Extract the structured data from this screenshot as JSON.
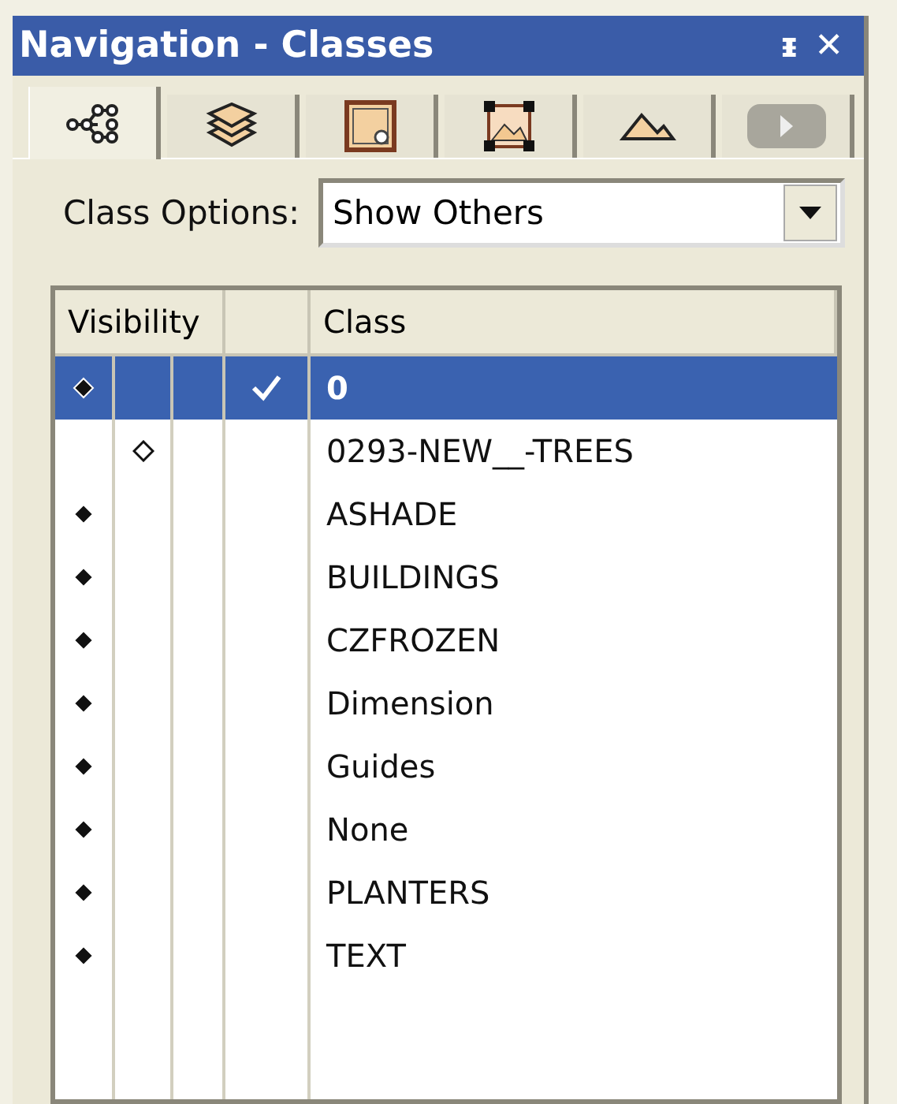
{
  "window": {
    "title": "Navigation - Classes",
    "pin": "ᵻ",
    "close": "✕"
  },
  "tabs": [
    {
      "kind": "hierarchy",
      "selected": true
    },
    {
      "kind": "layers",
      "selected": false
    },
    {
      "kind": "sheet",
      "selected": false
    },
    {
      "kind": "viewport",
      "selected": false
    },
    {
      "kind": "terrain",
      "selected": false
    },
    {
      "kind": "scroll",
      "selected": false
    }
  ],
  "class_options": {
    "label": "Class Options:",
    "value": "Show Others"
  },
  "table": {
    "columns": [
      "Visibility",
      "Class"
    ],
    "rows": [
      {
        "visible": true,
        "active": true,
        "selected": true,
        "class": "0"
      },
      {
        "visible": false,
        "active": false,
        "selected": false,
        "class": "0293-NEW__-TREES"
      },
      {
        "visible": true,
        "active": false,
        "selected": false,
        "class": "ASHADE"
      },
      {
        "visible": true,
        "active": false,
        "selected": false,
        "class": "BUILDINGS"
      },
      {
        "visible": true,
        "active": false,
        "selected": false,
        "class": "CZFROZEN"
      },
      {
        "visible": true,
        "active": false,
        "selected": false,
        "class": "Dimension"
      },
      {
        "visible": true,
        "active": false,
        "selected": false,
        "class": "Guides"
      },
      {
        "visible": true,
        "active": false,
        "selected": false,
        "class": "None"
      },
      {
        "visible": true,
        "active": false,
        "selected": false,
        "class": "PLANTERS"
      },
      {
        "visible": true,
        "active": false,
        "selected": false,
        "class": "TEXT"
      }
    ]
  }
}
